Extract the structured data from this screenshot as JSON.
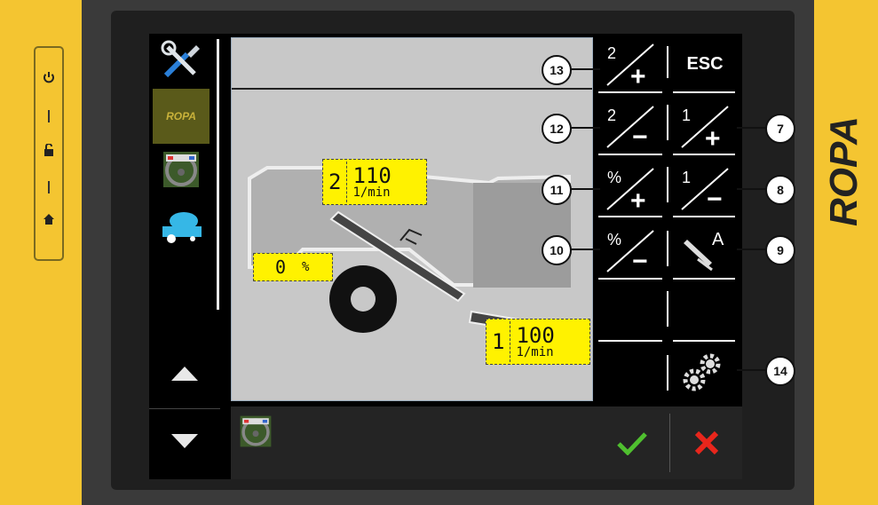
{
  "brand": {
    "text": "ROPA"
  },
  "hardware_buttons": [
    {
      "icon": "power-icon"
    },
    {
      "icon": "unlock-icon"
    },
    {
      "icon": "home-icon"
    }
  ],
  "sidebar": {
    "items": [
      {
        "icon": "tools-icon"
      },
      {
        "icon": "ropa-logo-icon",
        "label": "ROPA"
      },
      {
        "icon": "steering-wheel-icon"
      },
      {
        "icon": "tank-trailer-icon"
      }
    ]
  },
  "view": {
    "top_readout": {
      "index": "2",
      "value": "110",
      "unit": "1/min"
    },
    "percent_readout": {
      "value": "0",
      "unit": "%"
    },
    "bottom_readout": {
      "index": "1",
      "value": "100",
      "unit": "1/min"
    }
  },
  "softkeys": {
    "esc_label": "ESC",
    "items": [
      {
        "top": "2",
        "sign": "+",
        "callout": "13"
      },
      {
        "top": "2",
        "sign": "−",
        "callout": "12"
      },
      {
        "top": "1",
        "sign": "+",
        "callout": "7"
      },
      {
        "top": "%",
        "sign": "+",
        "callout": "11"
      },
      {
        "top": "1",
        "sign": "−",
        "callout": "8"
      },
      {
        "top": "%",
        "sign": "−",
        "callout": "10"
      },
      {
        "top": "A",
        "callout": "9"
      },
      {
        "callout": "14"
      }
    ]
  },
  "bottom_bar": {
    "confirm_icon": "checkmark-icon",
    "cancel_icon": "cross-icon",
    "colors": {
      "confirm": "#4fbf2f",
      "cancel": "#e8261c"
    }
  }
}
